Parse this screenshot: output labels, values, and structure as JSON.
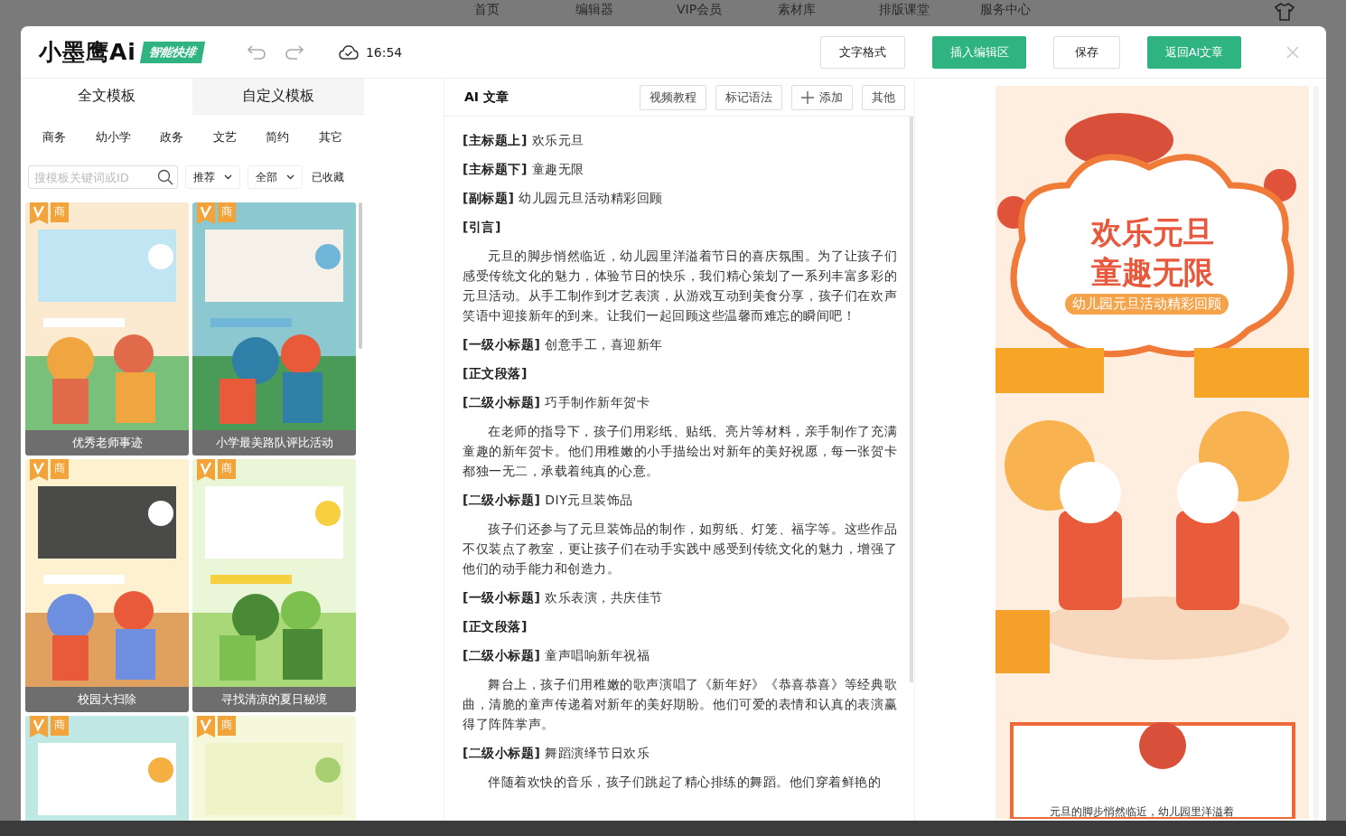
{
  "backdrop": {
    "nav": [
      "首页",
      "编辑器",
      "VIP会员",
      "素材库",
      "排版课堂",
      "服务中心"
    ]
  },
  "header": {
    "logo": "小墨鹰Ai",
    "logo_badge": "智能快排",
    "save_time": "16:54",
    "buttons": [
      {
        "label": "文字格式",
        "kind": "outline"
      },
      {
        "label": "插入编辑区",
        "kind": "primary"
      },
      {
        "label": "保存",
        "kind": "outline"
      },
      {
        "label": "返回AI文章",
        "kind": "primary"
      }
    ]
  },
  "templates": {
    "tabs": [
      {
        "label": "全文模板",
        "selected": true
      },
      {
        "label": "自定义模板",
        "selected": false
      }
    ],
    "categories": [
      "商务",
      "幼小学",
      "政务",
      "文艺",
      "简约",
      "其它"
    ],
    "search": {
      "placeholder": "搜模板关键词或ID"
    },
    "filters": [
      "推荐",
      "全部"
    ],
    "favorites": "已收藏",
    "cards": [
      {
        "caption": "优秀老师事迹",
        "badge": "商"
      },
      {
        "caption": "小学最美路队评比活动",
        "badge": "商"
      },
      {
        "caption": "校园大扫除",
        "badge": "商"
      },
      {
        "caption": "寻找清凉的夏日秘境",
        "badge": "商"
      },
      {
        "badge": "商"
      },
      {
        "badge": "商"
      }
    ]
  },
  "article": {
    "title": "AI 文章",
    "tools": [
      {
        "label": "视频教程",
        "kind": "plain"
      },
      {
        "label": "标记语法",
        "kind": "plain"
      },
      {
        "label": "添加",
        "kind": "add"
      },
      {
        "label": "其他",
        "kind": "plain"
      }
    ],
    "blocks": [
      {
        "kind": "heading",
        "tag": "[主标题上]",
        "text": "欢乐元旦"
      },
      {
        "kind": "heading",
        "tag": "[主标题下]",
        "text": "童趣无限"
      },
      {
        "kind": "heading",
        "tag": "[副标题]",
        "text": "幼儿园元旦活动精彩回顾"
      },
      {
        "kind": "heading",
        "tag": "[引言]"
      },
      {
        "kind": "paragraph",
        "text": "元旦的脚步悄然临近，幼儿园里洋溢着节日的喜庆氛围。为了让孩子们感受传统文化的魅力，体验节日的快乐，我们精心策划了一系列丰富多彩的元旦活动。从手工制作到才艺表演，从游戏互动到美食分享，孩子们在欢声笑语中迎接新年的到来。让我们一起回顾这些温馨而难忘的瞬间吧！"
      },
      {
        "kind": "heading",
        "tag": "[一级小标题]",
        "text": "创意手工，喜迎新年"
      },
      {
        "kind": "heading",
        "tag": "[正文段落]"
      },
      {
        "kind": "heading",
        "tag": "[二级小标题]",
        "text": "巧手制作新年贺卡"
      },
      {
        "kind": "paragraph",
        "text": "在老师的指导下，孩子们用彩纸、贴纸、亮片等材料，亲手制作了充满童趣的新年贺卡。他们用稚嫩的小手描绘出对新年的美好祝愿，每一张贺卡都独一无二，承载着纯真的心意。"
      },
      {
        "kind": "heading",
        "tag": "[二级小标题]",
        "text": "DIY元旦装饰品"
      },
      {
        "kind": "paragraph",
        "text": "孩子们还参与了元旦装饰品的制作，如剪纸、灯笼、福字等。这些作品不仅装点了教室，更让孩子们在动手实践中感受到传统文化的魅力，增强了他们的动手能力和创造力。"
      },
      {
        "kind": "heading",
        "tag": "[一级小标题]",
        "text": "欢乐表演，共庆佳节"
      },
      {
        "kind": "heading",
        "tag": "[正文段落]"
      },
      {
        "kind": "heading",
        "tag": "[二级小标题]",
        "text": "童声唱响新年祝福"
      },
      {
        "kind": "paragraph",
        "text": "舞台上，孩子们用稚嫩的歌声演唱了《新年好》《恭喜恭喜》等经典歌曲，清脆的童声传递着对新年的美好期盼。他们可爱的表情和认真的表演赢得了阵阵掌声。"
      },
      {
        "kind": "heading",
        "tag": "[二级小标题]",
        "text": "舞蹈演绎节日欢乐"
      },
      {
        "kind": "paragraph",
        "text": "伴随着欢快的音乐，孩子们跳起了精心排练的舞蹈。他们穿着鲜艳的"
      }
    ]
  },
  "preview": {
    "title_lines": [
      "欢乐元旦",
      "童趣无限"
    ],
    "subtitle": "幼儿园元旦活动精彩回顾",
    "body": "元旦的脚步悄然临近，幼儿园里洋溢着"
  }
}
